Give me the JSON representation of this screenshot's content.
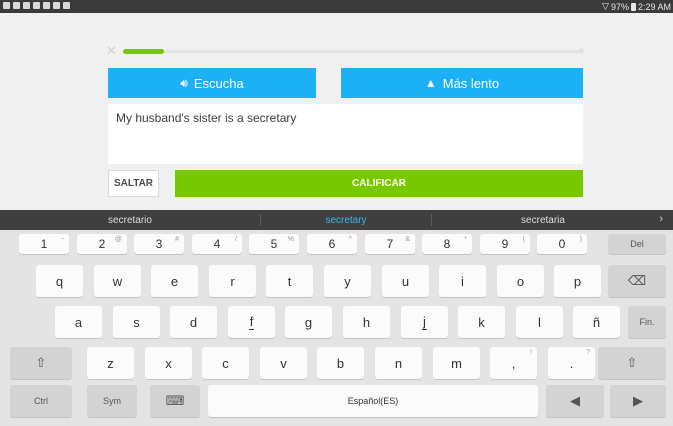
{
  "statusbar": {
    "battery": "97%",
    "time": "2:29 AM",
    "wifi_icon": "wifi-icon"
  },
  "lesson": {
    "progress_fraction": 0.09,
    "listen_label": "Escucha",
    "slow_label": "Más lento",
    "answer_text": "My husband's sister is a secretary",
    "skip_label": "SALTAR",
    "check_label": "CALIFICAR",
    "colors": {
      "accent_blue": "#1cb0f6",
      "accent_green": "#78c800"
    }
  },
  "keyboard": {
    "suggestions": [
      "secretario",
      "secretary",
      "secretaria"
    ],
    "selected_suggestion": "secretary",
    "row_numbers": [
      {
        "key": "1",
        "alt": "-"
      },
      {
        "key": "2",
        "alt": "@"
      },
      {
        "key": "3",
        "alt": "#"
      },
      {
        "key": "4",
        "alt": "/"
      },
      {
        "key": "5",
        "alt": "%"
      },
      {
        "key": "6",
        "alt": "^"
      },
      {
        "key": "7",
        "alt": "&"
      },
      {
        "key": "8",
        "alt": "*"
      },
      {
        "key": "9",
        "alt": "("
      },
      {
        "key": "0",
        "alt": ")"
      }
    ],
    "del_label": "Del",
    "row_q": [
      "q",
      "w",
      "e",
      "r",
      "t",
      "y",
      "u",
      "i",
      "o",
      "p"
    ],
    "row_a": [
      "a",
      "s",
      "d",
      "f",
      "g",
      "h",
      "j",
      "k",
      "l",
      "ñ"
    ],
    "fin_label": "Fin.",
    "row_z": [
      "z",
      "x",
      "c",
      "v",
      "b",
      "n",
      "m"
    ],
    "comma_label": ",",
    "comma_alt": "!",
    "period_label": ".",
    "period_alt": "?",
    "ctrl_label": "Ctrl",
    "sym_label": "Sym",
    "space_label": "Español(ES)"
  }
}
